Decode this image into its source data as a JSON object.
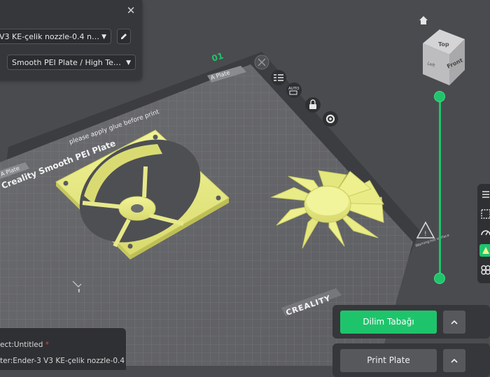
{
  "settings_panel": {
    "close_icon": "close-icon",
    "printer_select": "V3 KE-çelik nozzle-0.4 nozzle",
    "edit_icon": "pencil-icon",
    "plate_select": "Smooth PEI Plate / High Temp ..."
  },
  "plate": {
    "number": "01",
    "name_tab": "A Plate",
    "name_tab_left": "A Plate",
    "glue_notice": "please apply glue before print",
    "bed_label": "Creality Smooth PEI Plate",
    "brand": "CREALITY",
    "warning_text": "Warning:hot surface",
    "plate_tools": [
      "close-icon",
      "arrange-icon",
      "auto-orient-icon",
      "lock-icon",
      "settings-icon"
    ],
    "auto_label": "AUTO"
  },
  "view_cube": {
    "home_icon": "home-icon",
    "top": "Top",
    "left": "Left",
    "front": "Front"
  },
  "layer_slider": {
    "color": "#20c46a"
  },
  "side_toolbar": {
    "tools": [
      "variable-layer-icon",
      "grid-icon",
      "speed-icon",
      "paint-icon",
      "support-icon"
    ]
  },
  "buttons": {
    "slice": "Dilim Tabağı",
    "print": "Print Plate"
  },
  "info": {
    "project_prefix": "ect:",
    "project_name": "Untitled",
    "modified_mark": "*",
    "printer_prefix": "ter:",
    "printer_name": "Ender-3 V3 KE-çelik nozzle-0.4"
  },
  "colors": {
    "model": "#eef08e",
    "accent": "#1ec46b"
  }
}
